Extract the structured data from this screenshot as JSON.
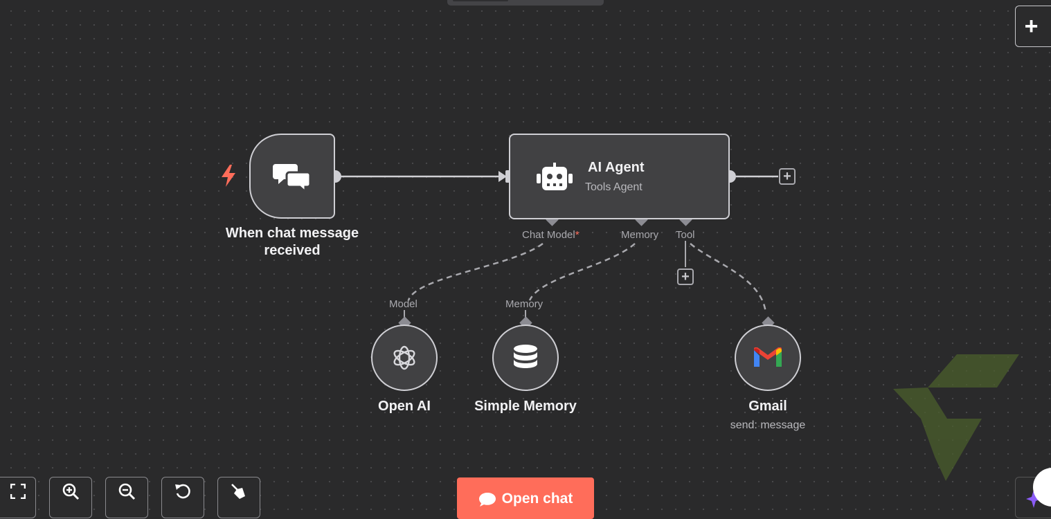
{
  "canvas": {
    "add_node_icon": "plus-icon",
    "top_tab": "panel-tab"
  },
  "nodes": {
    "trigger": {
      "label": "When chat message received",
      "label_line1": "When chat message",
      "label_line2": "received",
      "icon": "chat-bubbles-icon",
      "trigger_icon": "lightning-icon",
      "trigger_color": "#ff6d5a"
    },
    "agent": {
      "title": "AI Agent",
      "subtitle": "Tools Agent",
      "icon": "robot-icon",
      "ports": {
        "chat_model": "Chat Model",
        "chat_model_required": "*",
        "memory": "Memory",
        "tool": "Tool"
      }
    },
    "openai": {
      "label": "Open AI",
      "port_label": "Model",
      "icon": "openai-icon"
    },
    "memory": {
      "label": "Simple Memory",
      "port_label": "Memory",
      "icon": "database-icon"
    },
    "gmail": {
      "label": "Gmail",
      "subtitle": "send: message",
      "icon": "gmail-icon"
    }
  },
  "toolbar": {
    "buttons": [
      {
        "name": "fit-view",
        "icon": "fullscreen-icon"
      },
      {
        "name": "zoom-in",
        "icon": "zoom-in-icon"
      },
      {
        "name": "zoom-out",
        "icon": "zoom-out-icon"
      },
      {
        "name": "reset-zoom",
        "icon": "undo-icon"
      },
      {
        "name": "tidy-up",
        "icon": "broom-icon"
      }
    ],
    "open_chat_label": "Open chat",
    "open_chat_icon": "chat-icon"
  },
  "colors": {
    "background": "#2a2a2b",
    "node_fill": "#414143",
    "node_border": "#cfcfd4",
    "accent": "#ff6d5a",
    "watermark": "#4a5e2c"
  },
  "watermark": {
    "icon": "brand-logo-watermark"
  }
}
